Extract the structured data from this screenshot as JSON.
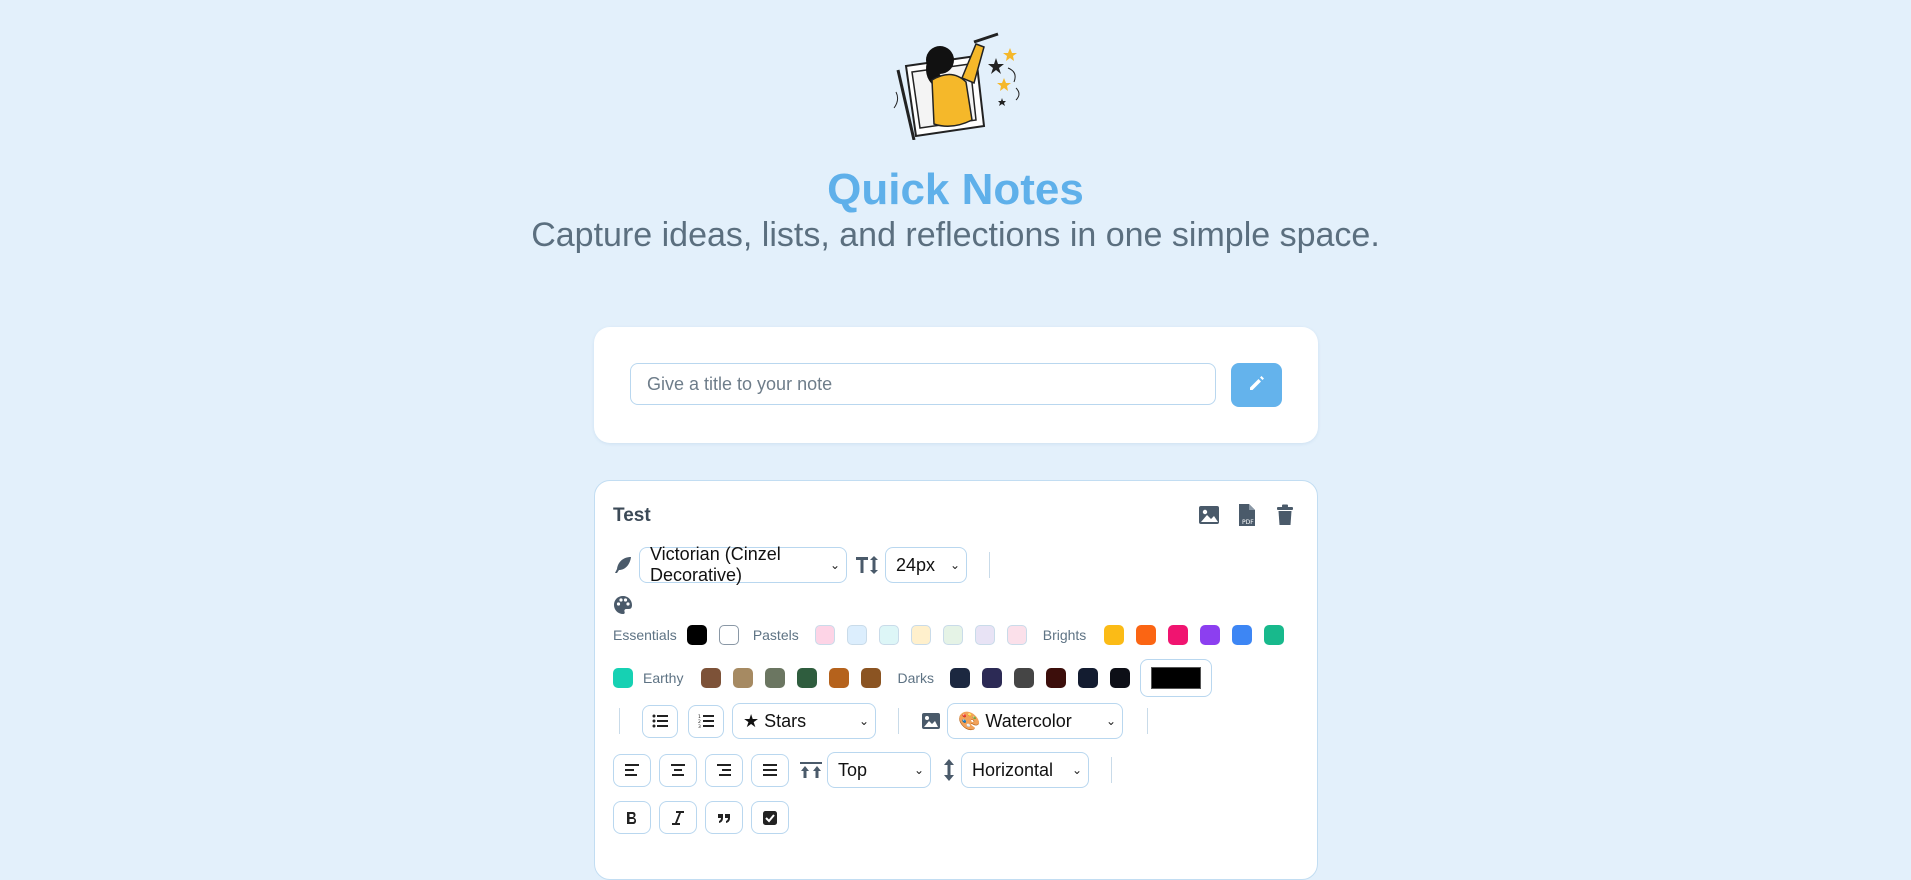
{
  "header": {
    "title": "Quick Notes",
    "subtitle": "Capture ideas, lists, and reflections in one simple space.",
    "illustration": "woman-painting-illustration"
  },
  "new_note": {
    "placeholder": "Give a title to your note",
    "button_icon": "pencil-icon"
  },
  "note": {
    "title": "Test",
    "actions": [
      "image-export-icon",
      "pdf-export-icon",
      "trash-icon"
    ],
    "font_family": "Victorian (Cinzel Decorative)",
    "font_size": "24px",
    "palette": {
      "essentials_label": "Essentials",
      "essentials": [
        "#000000",
        "#ffffff"
      ],
      "pastels_label": "Pastels",
      "pastels": [
        "#fdd4e6",
        "#dceefd",
        "#ddf6f7",
        "#fff0cc",
        "#e5f3e6",
        "#e8e3f5",
        "#fbe0ea"
      ],
      "brights_label": "Brights",
      "brights": [
        "#fbbb16",
        "#fb6513",
        "#f01470",
        "#8c3ff0",
        "#3d86f4",
        "#18b98c",
        "#16d1b3"
      ],
      "earthy_label": "Earthy",
      "earthy": [
        "#7d5238",
        "#a68a62",
        "#6b7661",
        "#2f5d3e",
        "#b5621c",
        "#8b5422"
      ],
      "darks_label": "Darks",
      "darks": [
        "#1c2840",
        "#2c2a55",
        "#454545",
        "#3c0e0b",
        "#131c30",
        "#0d0f17"
      ],
      "current_color": "#000000"
    },
    "list_style": "★ Stars",
    "background_style": "🎨 Watercolor",
    "vertical_align": "Top",
    "orientation": "Horizontal"
  }
}
